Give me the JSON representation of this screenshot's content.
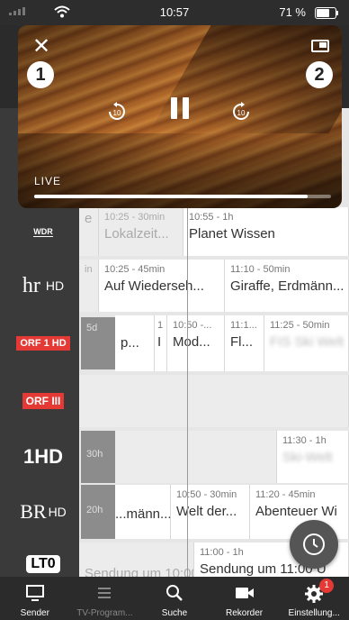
{
  "status_bar": {
    "time": "10:57",
    "battery": "71 %"
  },
  "player": {
    "live_label": "LIVE",
    "badge_1": "1",
    "badge_2": "2",
    "skip_back": "10",
    "skip_forward": "10",
    "progress": 0.92
  },
  "channels": [
    {
      "name": "WDR",
      "logo_text": "WDR"
    },
    {
      "name": "hr HD",
      "logo_text": "hr",
      "suffix": "HD"
    },
    {
      "name": "ORF 1 HD",
      "logo_text": "ORF 1 HD"
    },
    {
      "name": "ORF III",
      "logo_text": "ORF III"
    },
    {
      "name": "ONE HD",
      "logo_text": "1HD"
    },
    {
      "name": "BR HD",
      "logo_text": "BR",
      "suffix": "HD"
    },
    {
      "name": "LT0",
      "logo_text": "LT0"
    }
  ],
  "rows": {
    "wdr": {
      "c1": {
        "time": "10:25 - 30min",
        "title": "Lokalzeit..."
      },
      "c2": {
        "time": "10:55 - 1h",
        "title": "Planet Wissen"
      }
    },
    "hr": {
      "c1": {
        "time": "10:25 - 45min",
        "title": "Auf Wiederseh..."
      },
      "c2": {
        "time": "11:10 - 50min",
        "title": "Giraffe, Erdmänn..."
      }
    },
    "orf1": {
      "gray": "5d",
      "c1": {
        "title": "p..."
      },
      "c2": {
        "time": "1",
        "title": "I"
      },
      "c3": {
        "time": "10:50 -...",
        "title": "Mod..."
      },
      "c4": {
        "time": "11:1...",
        "title": "Fl..."
      },
      "c5": {
        "time": "11:25 - 50min",
        "title": "FIS Ski Welt"
      }
    },
    "one": {
      "gray": "30h",
      "c1": {
        "time": "11:30 - 1h",
        "title": "Ski-Welt"
      }
    },
    "br": {
      "gray": "20h",
      "c1": {
        "title": "...männ..."
      },
      "c2": {
        "time": "10:50 - 30min",
        "title": "Welt der..."
      },
      "c3": {
        "time": "11:20 - 45min",
        "title": "Abenteuer Wi"
      }
    },
    "lto": {
      "c1": {
        "title": "Sendung um 10:00 U"
      },
      "c2": {
        "time": "11:00 - 1h",
        "title": "Sendung um 11:00 U"
      }
    }
  },
  "tabs": [
    {
      "label": "Sender"
    },
    {
      "label": "TV-Program..."
    },
    {
      "label": "Suche"
    },
    {
      "label": "Rekorder"
    },
    {
      "label": "Einstellung...",
      "badge": "1"
    }
  ]
}
